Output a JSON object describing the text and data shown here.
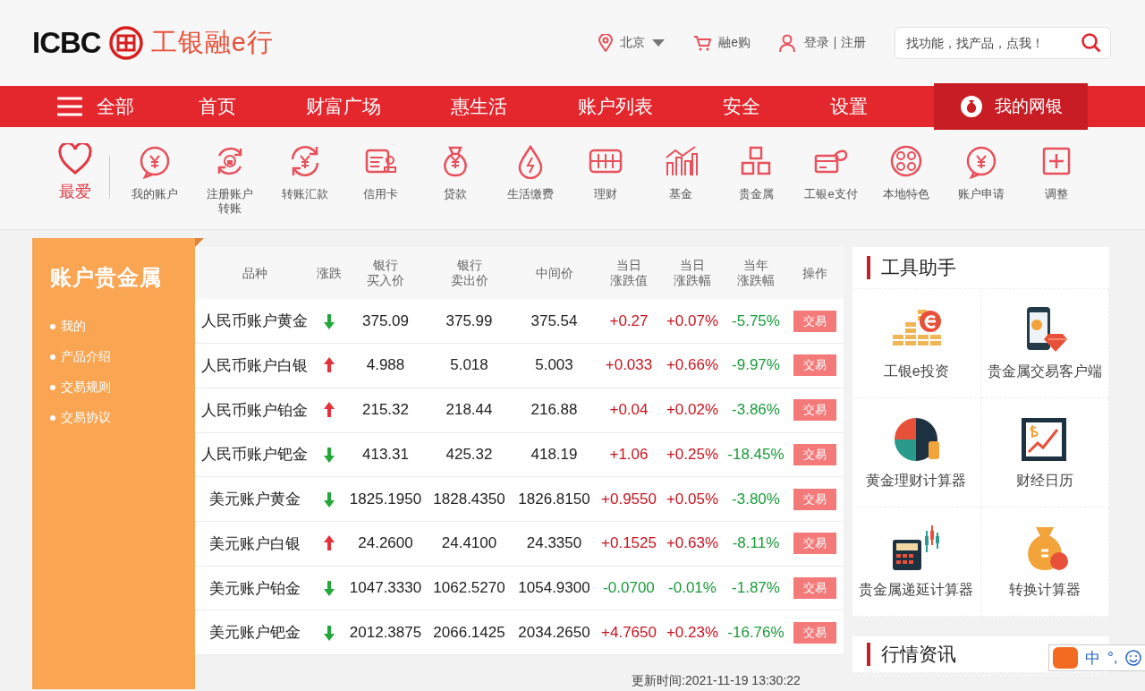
{
  "header": {
    "logo_en": "ICBC",
    "logo_cn": "工银融e行",
    "city": "北京",
    "shop": "融e购",
    "login": "登录",
    "register": "注册",
    "search": {
      "placeholder": "找功能，找产品，点我！"
    }
  },
  "nav": {
    "menu_label": "全部",
    "items": [
      {
        "label": "首页"
      },
      {
        "label": "财富广场"
      },
      {
        "label": "惠生活"
      },
      {
        "label": "账户列表"
      },
      {
        "label": "安全"
      },
      {
        "label": "设置"
      }
    ],
    "my_bank": "我的网银"
  },
  "shortcuts": {
    "favorite": "最爱",
    "items": [
      {
        "label": "我的账户"
      },
      {
        "label": "注册账户转账"
      },
      {
        "label": "转账汇款"
      },
      {
        "label": "信用卡"
      },
      {
        "label": "贷款"
      },
      {
        "label": "生活缴费"
      },
      {
        "label": "理财"
      },
      {
        "label": "基金"
      },
      {
        "label": "贵金属"
      },
      {
        "label": "工银e支付"
      },
      {
        "label": "本地特色"
      },
      {
        "label": "账户申请"
      },
      {
        "label": "调整"
      }
    ]
  },
  "sidebar": {
    "title": "账户贵金属",
    "items": [
      "我的",
      "产品介绍",
      "交易规则",
      "交易协议"
    ]
  },
  "table": {
    "columns": [
      {
        "lines": [
          "品种"
        ]
      },
      {
        "lines": [
          "涨跌"
        ]
      },
      {
        "lines": [
          "银行",
          "买入价"
        ]
      },
      {
        "lines": [
          "银行",
          "卖出价"
        ]
      },
      {
        "lines": [
          "中间价"
        ]
      },
      {
        "lines": [
          "当日",
          "涨跌值"
        ]
      },
      {
        "lines": [
          "当日",
          "涨跌幅"
        ]
      },
      {
        "lines": [
          "当年",
          "涨跌幅"
        ]
      },
      {
        "lines": [
          "操作"
        ]
      }
    ],
    "rows": [
      {
        "name": "人民币账户黄金",
        "rising": false,
        "buy": "375.09",
        "sell": "375.99",
        "mid": "375.54",
        "day_change": "+0.27",
        "day_pct": "+0.07%",
        "day_rising": true,
        "year_pct": "-5.75%",
        "year_rising": false,
        "action": "交易"
      },
      {
        "name": "人民币账户白银",
        "rising": true,
        "buy": "4.988",
        "sell": "5.018",
        "mid": "5.003",
        "day_change": "+0.033",
        "day_pct": "+0.66%",
        "day_rising": true,
        "year_pct": "-9.97%",
        "year_rising": false,
        "action": "交易"
      },
      {
        "name": "人民币账户铂金",
        "rising": true,
        "buy": "215.32",
        "sell": "218.44",
        "mid": "216.88",
        "day_change": "+0.04",
        "day_pct": "+0.02%",
        "day_rising": true,
        "year_pct": "-3.86%",
        "year_rising": false,
        "action": "交易"
      },
      {
        "name": "人民币账户钯金",
        "rising": false,
        "buy": "413.31",
        "sell": "425.32",
        "mid": "418.19",
        "day_change": "+1.06",
        "day_pct": "+0.25%",
        "day_rising": true,
        "year_pct": "-18.45%",
        "year_rising": false,
        "action": "交易"
      },
      {
        "name": "美元账户黄金",
        "rising": false,
        "buy": "1825.1950",
        "sell": "1828.4350",
        "mid": "1826.8150",
        "day_change": "+0.9550",
        "day_pct": "+0.05%",
        "day_rising": true,
        "year_pct": "-3.80%",
        "year_rising": false,
        "action": "交易"
      },
      {
        "name": "美元账户白银",
        "rising": true,
        "buy": "24.2600",
        "sell": "24.4100",
        "mid": "24.3350",
        "day_change": "+0.1525",
        "day_pct": "+0.63%",
        "day_rising": true,
        "year_pct": "-8.11%",
        "year_rising": false,
        "action": "交易"
      },
      {
        "name": "美元账户铂金",
        "rising": false,
        "buy": "1047.3330",
        "sell": "1062.5270",
        "mid": "1054.9300",
        "day_change": "-0.0700",
        "day_pct": "-0.01%",
        "day_rising": false,
        "year_pct": "-1.87%",
        "year_rising": false,
        "action": "交易"
      },
      {
        "name": "美元账户钯金",
        "rising": false,
        "buy": "2012.3875",
        "sell": "2066.1425",
        "mid": "2034.2650",
        "day_change": "+4.7650",
        "day_pct": "+0.23%",
        "day_rising": true,
        "year_pct": "-16.76%",
        "year_rising": false,
        "action": "交易"
      }
    ],
    "update_time": "更新时间:2021-11-19 13:30:22"
  },
  "tools": {
    "title": "工具助手",
    "items": [
      {
        "label": "工银e投资"
      },
      {
        "label": "贵金属交易客户端"
      },
      {
        "label": "黄金理财计算器"
      },
      {
        "label": "财经日历"
      },
      {
        "label": "贵金属递延计算器"
      },
      {
        "label": "转换计算器"
      }
    ],
    "news_title": "行情资讯"
  },
  "ime": {
    "mode": "中",
    "punct": "°,"
  }
}
